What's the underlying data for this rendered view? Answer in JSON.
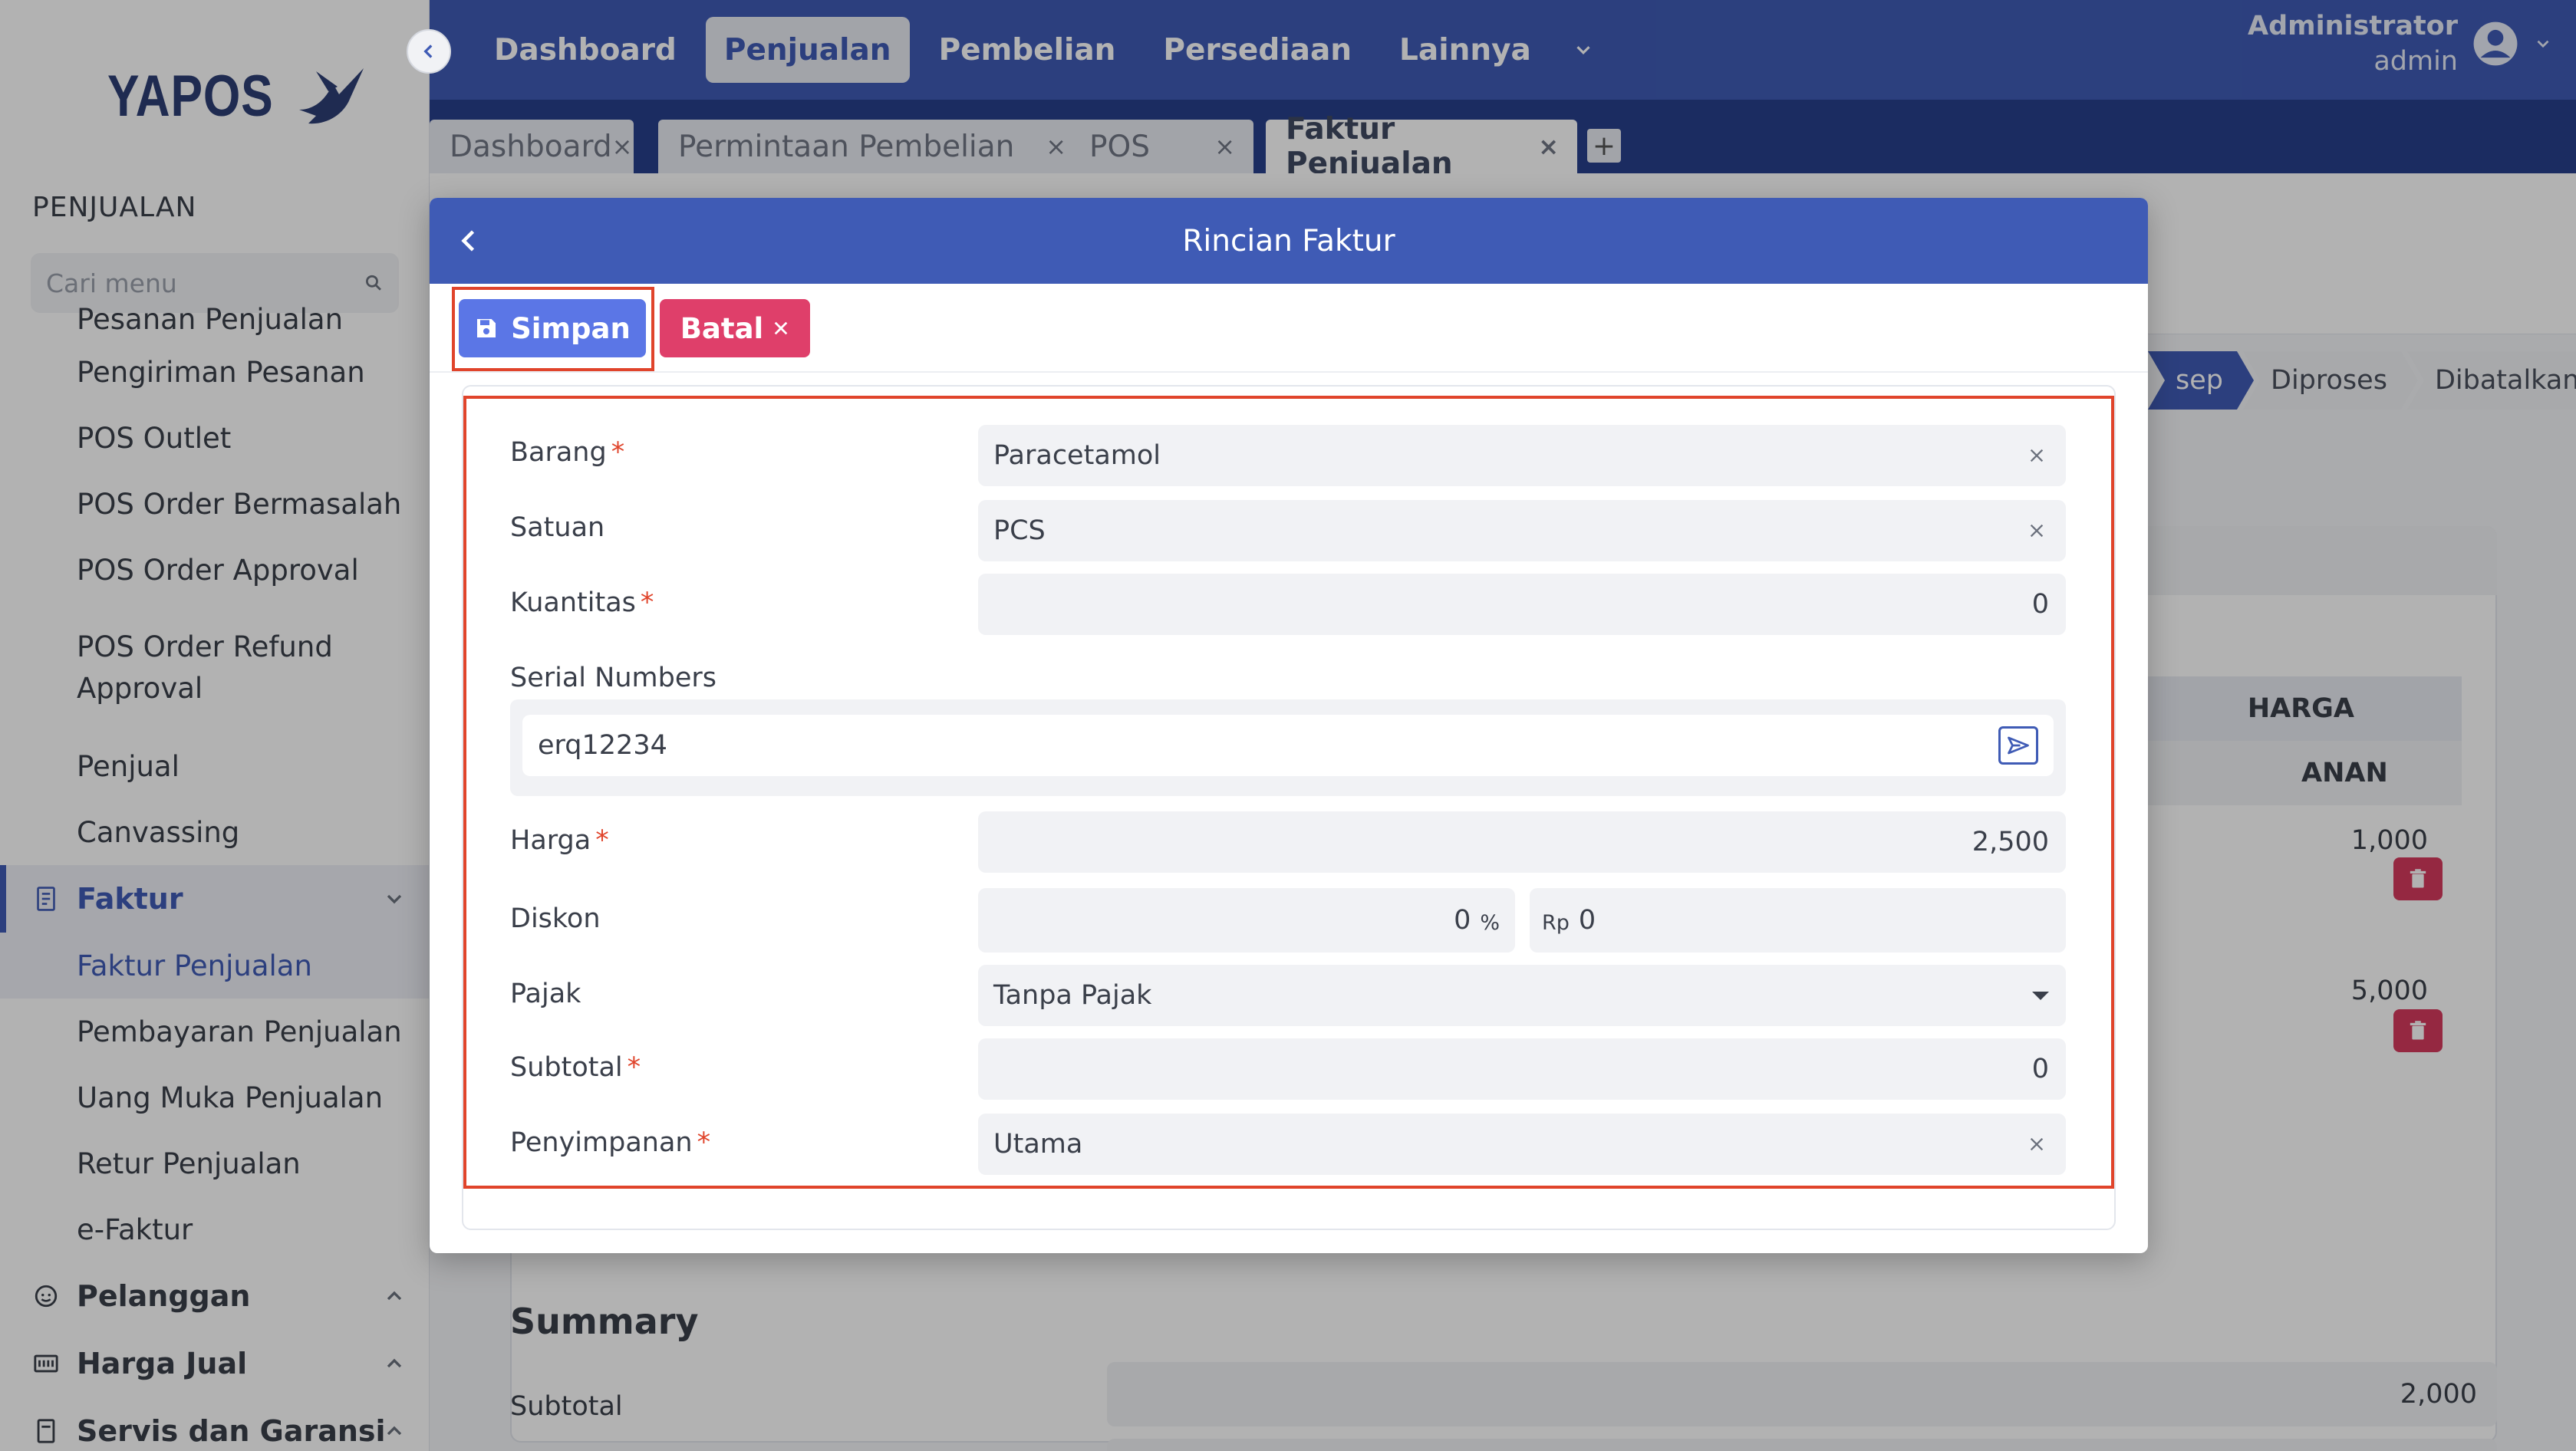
{
  "app": {
    "logo_text": "YAPOS"
  },
  "sidebar": {
    "section_title": "PENJUALAN",
    "search_placeholder": "Cari menu",
    "items": [
      {
        "label": "Pesanan Penjualan"
      },
      {
        "label": "Pengiriman Pesanan"
      },
      {
        "label": "POS Outlet"
      },
      {
        "label": "POS Order Bermasalah"
      },
      {
        "label": "POS Order Approval"
      },
      {
        "label": "POS Order Refund Approval"
      },
      {
        "label": "Penjual"
      },
      {
        "label": "Canvassing"
      }
    ],
    "group_faktur": {
      "label": "Faktur",
      "items": [
        {
          "label": "Faktur Penjualan",
          "active": true
        },
        {
          "label": "Pembayaran Penjualan"
        },
        {
          "label": "Uang Muka Penjualan"
        },
        {
          "label": "Retur Penjualan"
        },
        {
          "label": "e-Faktur"
        }
      ]
    },
    "group_pelanggan": {
      "label": "Pelanggan"
    },
    "group_harga_jual": {
      "label": "Harga Jual"
    },
    "group_servis": {
      "label": "Servis dan Garansi"
    }
  },
  "topnav": {
    "items": [
      {
        "label": "Dashboard"
      },
      {
        "label": "Penjualan",
        "active": true
      },
      {
        "label": "Pembelian"
      },
      {
        "label": "Persediaan"
      },
      {
        "label": "Lainnya"
      }
    ],
    "user_name": "Administrator",
    "user_role": "admin"
  },
  "tabs": [
    {
      "label": "Dashboard"
    },
    {
      "label": "Permintaan Pembelian"
    },
    {
      "label": "POS"
    },
    {
      "label": "Faktur Penjualan",
      "active": true
    }
  ],
  "background": {
    "steps": [
      "sep",
      "Diproses",
      "Dibatalkan"
    ],
    "table_header": "HARGA",
    "table_subheader": "ANAN",
    "prices": [
      "1,000",
      "5,000"
    ],
    "summary_title": "Summary",
    "summary_subtotal_label": "Subtotal",
    "summary_subtotal_value": "2,000"
  },
  "modal": {
    "title": "Rincian Faktur",
    "save_label": "Simpan",
    "cancel_label": "Batal",
    "fields": {
      "barang": {
        "label": "Barang",
        "value": "Paracetamol"
      },
      "satuan": {
        "label": "Satuan",
        "value": "PCS"
      },
      "kuantitas": {
        "label": "Kuantitas",
        "value": "0"
      },
      "serial": {
        "label": "Serial Numbers",
        "value": "erq12234"
      },
      "harga": {
        "label": "Harga",
        "value": "2,500"
      },
      "diskon": {
        "label": "Diskon",
        "percent_value": "0",
        "percent_unit": "%",
        "rp_unit": "Rp",
        "rp_value": "0"
      },
      "pajak": {
        "label": "Pajak",
        "value": "Tanpa Pajak"
      },
      "subtotal": {
        "label": "Subtotal",
        "value": "0"
      },
      "penyimpanan": {
        "label": "Penyimpanan",
        "value": "Utama"
      }
    },
    "required_mark": "*"
  },
  "colors": {
    "primary": "#3f5bb5",
    "primary_dark": "#283f8c",
    "save_button": "#5b76e6",
    "cancel_button": "#df3f6a",
    "highlight": "#e0442b",
    "danger": "#d63a5d"
  },
  "icons": {
    "search": "search-icon",
    "save": "floppy-disk-icon",
    "close": "close-icon",
    "back": "chevron-left-icon",
    "send": "send-icon",
    "trash": "trash-icon",
    "user": "user-avatar-icon"
  }
}
